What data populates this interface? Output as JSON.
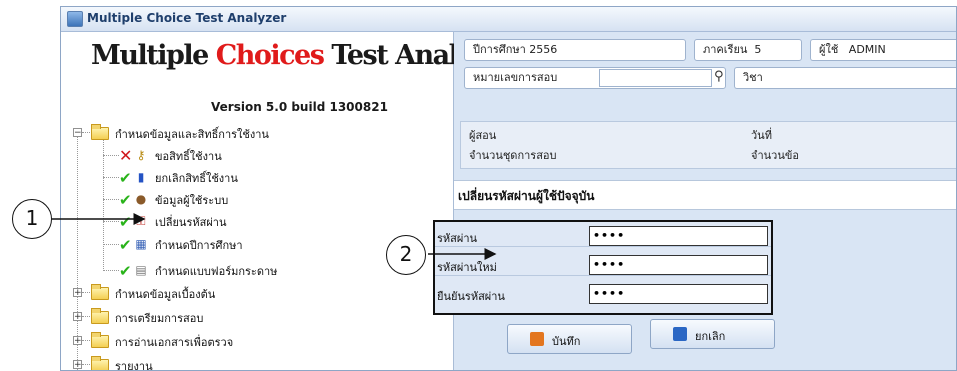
{
  "window": {
    "title": "Multiple Choice Test Analyzer"
  },
  "logo": {
    "part1": "Multiple ",
    "part2": "Choices",
    "part3": " Test Analyzer",
    "version": "Version 5.0  build 1300821"
  },
  "tree": {
    "root1": "กำหนดข้อมูลและสิทธิ์การใช้งาน",
    "children": [
      "ขอสิทธิ์ใช้งาน",
      "ยกเลิกสิทธิ์ใช้งาน",
      "ข้อมูลผู้ใช้ระบบ",
      "เปลี่ยนรหัสผ่าน",
      "กำหนดปีการศึกษา",
      "กำหนดแบบฟอร์มกระดาษ"
    ],
    "others": [
      "กำหนดข้อมูลเบื้องต้น",
      "การเตรียมการสอบ",
      "การอ่านเอกสารเพื่อตรวจ",
      "รายงาน"
    ]
  },
  "info": {
    "year": "ปีการศึกษา  2556",
    "term_label": "ภาคเรียน",
    "term_value": "5",
    "user_label": "ผู้ใช้",
    "user_value": "ADMIN",
    "exam_no_label": "หมายเลขการสอบ",
    "exam_no_value": "",
    "subject_label": "วิชา",
    "teacher_label": "ผู้สอน",
    "date_label": "วันที่",
    "sets_label": "จำนวนชุดการสอบ",
    "items_label": "จำนวนข้อ"
  },
  "section": {
    "title": "เปลี่ยนรหัสผ่านผู้ใช้ปัจจุบัน"
  },
  "form": {
    "current_label": "รหัสผ่าน",
    "current_value": "••••",
    "new_label": "รหัสผ่านใหม่",
    "new_value": "••••",
    "confirm_label": "ยืนยันรหัสผ่าน",
    "confirm_value": "••••"
  },
  "buttons": {
    "save": "บันทึก",
    "cancel": "ยกเลิก"
  },
  "callouts": {
    "one": "1",
    "two": "2"
  },
  "colors": {
    "logo_red": "#e01b1b",
    "check_green": "#29b31a",
    "panel_bg": "#d9e5f4"
  }
}
